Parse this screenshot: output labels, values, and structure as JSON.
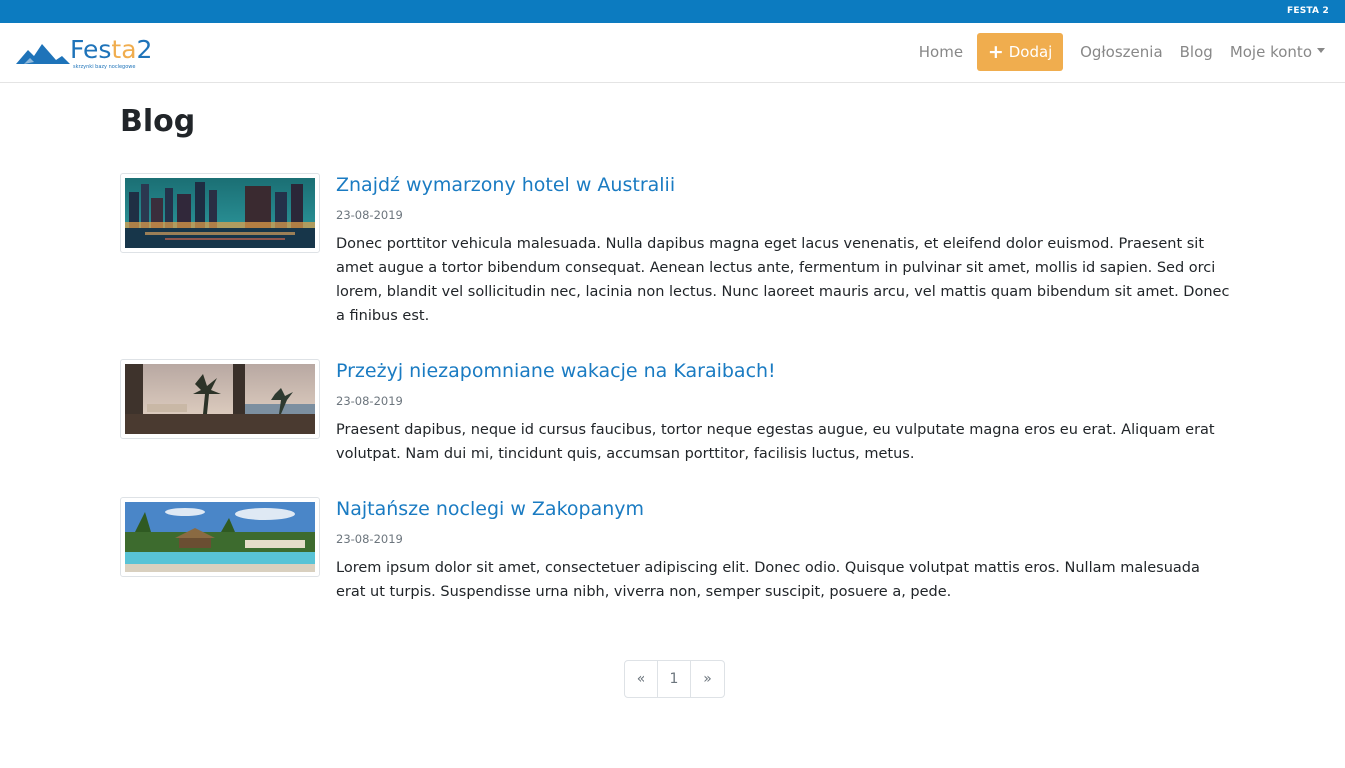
{
  "topbar": {
    "label": "FESTA 2"
  },
  "logo": {
    "text_main": "Fes",
    "text_accent": "ta",
    "text_suffix": "2",
    "tagline": "skrzynki bazy noclegowe"
  },
  "nav": {
    "home": "Home",
    "add_button": "Dodaj",
    "listings": "Ogłoszenia",
    "blog": "Blog",
    "account": "Moje konto"
  },
  "page": {
    "title": "Blog"
  },
  "posts": [
    {
      "title": "Znajdź wymarzony hotel w Australii",
      "date": "23-08-2019",
      "excerpt": "Donec porttitor vehicula malesuada. Nulla dapibus magna eget lacus venenatis, et eleifend dolor euismod. Praesent sit amet augue a tortor bibendum consequat. Aenean lectus ante, fermentum in pulvinar sit amet, mollis id sapien. Sed orci lorem, blandit vel sollicitudin nec, lacinia non lectus. Nunc laoreet mauris arcu, vel mattis quam bibendum sit amet. Donec a finibus est."
    },
    {
      "title": "Przeżyj niezapomniane wakacje na Karaibach!",
      "date": "23-08-2019",
      "excerpt": "Praesent dapibus, neque id cursus faucibus, tortor neque egestas augue, eu vulputate magna eros eu erat. Aliquam erat volutpat. Nam dui mi, tincidunt quis, accumsan porttitor, facilisis luctus, metus."
    },
    {
      "title": "Najtańsze noclegi w Zakopanym",
      "date": "23-08-2019",
      "excerpt": "Lorem ipsum dolor sit amet, consectetuer adipiscing elit. Donec odio. Quisque volutpat mattis eros. Nullam malesuada erat ut turpis. Suspendisse urna nibh, viverra non, semper suscipit, posuere a, pede."
    }
  ],
  "pagination": {
    "prev": "«",
    "current": "1",
    "next": "»"
  },
  "colors": {
    "topbar": "#0c7bc0",
    "accent": "#f0ad4e",
    "link": "#1a7bc2"
  }
}
